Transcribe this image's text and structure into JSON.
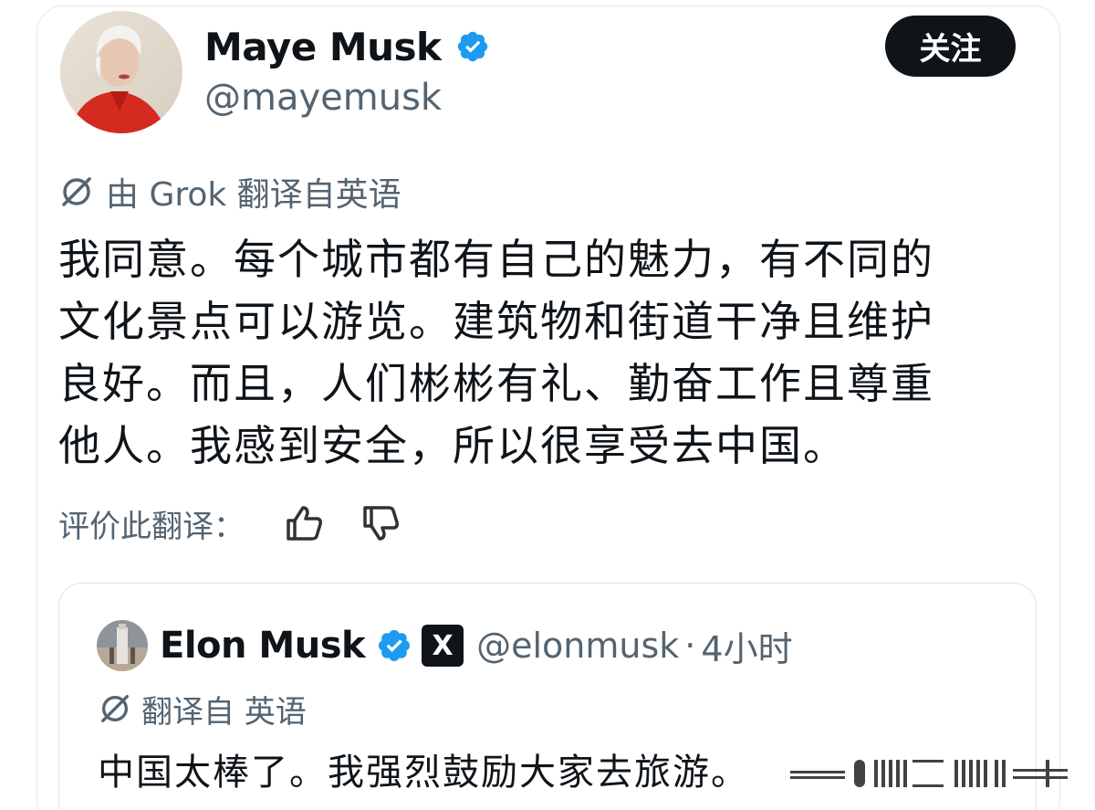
{
  "author": {
    "name": "Maye Musk",
    "handle": "@mayemusk",
    "verified_color": "#1d9bf0"
  },
  "follow_button": {
    "label": "关注"
  },
  "translation": {
    "notice": "由 Grok 翻译自英语",
    "icon": "translate-icon"
  },
  "tweet": {
    "lines": [
      "我同意。每个城市都有自己的魅力，有不同的",
      "文化景点可以游览。建筑物和街道干净且维护",
      "良好。而且，人们彬彬有礼、勤奋工作且尊重",
      "他人。我感到安全，所以很享受去中国。"
    ]
  },
  "rating": {
    "label": "评价此翻译：",
    "like_icon": "thumbs-up-icon",
    "dislike_icon": "thumbs-down-icon"
  },
  "quoted": {
    "name": "Elon Musk",
    "badge": "X",
    "handle": "@elonmusk",
    "separator": "·",
    "time": "4小时",
    "translation_notice": "翻译自 英语",
    "text": "中国太棒了。我强烈鼓励大家去旅游。"
  },
  "colors": {
    "text": "#0f1419",
    "secondary": "#536471",
    "verified": "#1d9bf0",
    "button": "#0f1419"
  }
}
